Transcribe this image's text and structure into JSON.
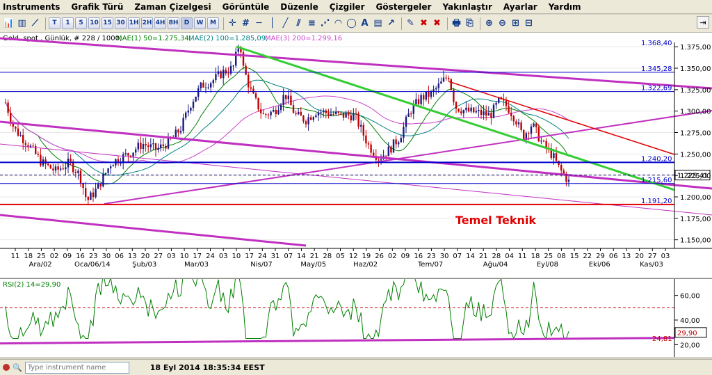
{
  "menu": [
    "Instruments",
    "Grafik Türü",
    "Zaman Çizelgesi",
    "Görüntüle",
    "Düzenle",
    "Çizgiler",
    "Göstergeler",
    "Yakınlaştır",
    "Ayarlar",
    "Yardım"
  ],
  "toolbar": {
    "period_buttons": [
      "T",
      "1",
      "5",
      "10",
      "15",
      "30",
      "1H",
      "2H",
      "4H",
      "8H",
      "D",
      "W",
      "M"
    ]
  },
  "chart": {
    "header_instrument": "Gold, spot , Günlük, # 228 / 1000,",
    "mae1": "MAE(1) 50=1.275,34,",
    "mae2": "MAE(2) 100=1.285,09,",
    "mae3": "MAE(3) 200=1.299,16",
    "annotation": "Temel Teknik",
    "price_ticks": [
      "1.375,00",
      "1.350,00",
      "1.325,00",
      "1.300,00",
      "1.275,00",
      "1.250,00",
      "1.225,00",
      "1.200,00",
      "1.175,00",
      "1.150,00"
    ],
    "level_labels": [
      "1.368,40",
      "1.345,28",
      "1.322,69",
      "1.240,20",
      "1.215,60",
      "1.191,20"
    ],
    "last_price": "1.225,41",
    "day_ticks": [
      "11",
      "18",
      "25",
      "02",
      "09",
      "16",
      "23",
      "30",
      "06",
      "13",
      "20",
      "27",
      "03",
      "10",
      "17",
      "24",
      "03",
      "10",
      "17",
      "24",
      "31",
      "07",
      "14",
      "21",
      "28",
      "05",
      "12",
      "19",
      "26",
      "02",
      "09",
      "16",
      "23",
      "30",
      "07",
      "14",
      "21",
      "28",
      "04",
      "11",
      "18",
      "25",
      "08",
      "15",
      "22",
      "29",
      "06",
      "13",
      "20",
      "27",
      "03",
      "10"
    ],
    "month_labels": [
      "Ara/02",
      "Oca/06/14",
      "Şub/03",
      "Mar/03",
      "Nis/07",
      "May/05",
      "Haz/02",
      "Tem/07",
      "Ağu/04",
      "Eyl/08",
      "Eki/06",
      "Kas/03"
    ]
  },
  "rsi": {
    "label": "RSI(2) 14=29,90",
    "ticks": [
      "60,00",
      "40,00",
      "20,00"
    ],
    "value_label": "29,90",
    "trend_label": "24,81"
  },
  "status": {
    "instrument_placeholder": "Type instrument name",
    "datetime": "18 Eyl 2014 18:35:34 EEST"
  },
  "colors": {
    "candle_up": "#1a1a80",
    "candle_down": "#c00000",
    "ma50": "#008000",
    "ma100": "#008080",
    "ma200": "#cc44cc",
    "trend_magenta": "#c030c0",
    "trend_green": "#33cc33",
    "trend_red": "#e00000",
    "level_blue": "#0000cc",
    "annotation": "#e00000"
  }
}
